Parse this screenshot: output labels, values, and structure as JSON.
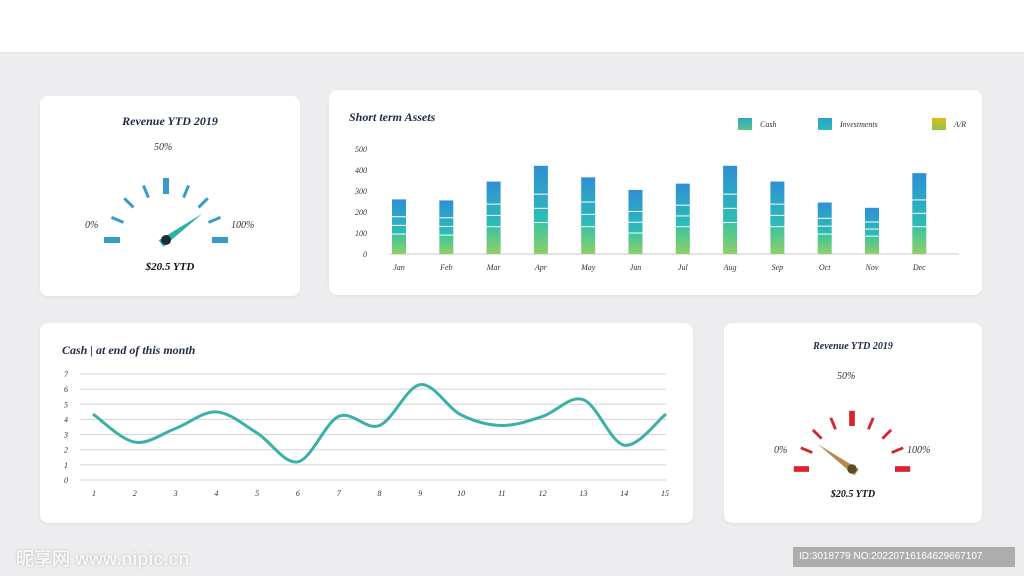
{
  "colors": {
    "teal": "#3ab0a6",
    "gauge_blue": "#3a9bc9",
    "gauge_red": "#d9242d",
    "cash_green": "#5cc481",
    "investments_blue": "#2ea5c8",
    "ar_gold": "#e6b817"
  },
  "gauge_top": {
    "title": "Revenue YTD 2019",
    "label_mid": "50%",
    "label_min": "0%",
    "label_max": "100%",
    "value_text": "$20.5 YTD",
    "needle_percent": 80,
    "color": "#3a9bc9",
    "icons": {
      "needle": "needle-icon"
    }
  },
  "gauge_bottom": {
    "title": "Revenue YTD 2019",
    "label_mid": "50%",
    "label_min": "0%",
    "label_max": "100%",
    "value_text": "$20.5 YTD",
    "needle_percent": 20,
    "color": "#d9242d",
    "icons": {
      "needle": "needle-icon"
    }
  },
  "bar_panel": {
    "title": "Short term Assets",
    "legend": [
      {
        "label": "Cash",
        "color": "#5cc481"
      },
      {
        "label": "Investments",
        "color": "#2ea5c8"
      },
      {
        "label": "A/R",
        "color": "#e6b817"
      }
    ]
  },
  "line_panel": {
    "title": "Cash | at end of this month"
  },
  "chart_data": [
    {
      "type": "bar",
      "title": "Short term Assets",
      "categories": [
        "Jan",
        "Feb",
        "Mar",
        "Apr",
        "May",
        "Jun",
        "Jul",
        "Aug",
        "Sep",
        "Oct",
        "Nov",
        "Dec"
      ],
      "y_ticks": [
        0,
        100,
        200,
        300,
        400,
        500
      ],
      "ylim": [
        0,
        500
      ],
      "total_values": [
        260,
        255,
        345,
        420,
        365,
        305,
        335,
        420,
        345,
        245,
        220,
        385
      ],
      "series": [
        {
          "name": "Cash",
          "values": [
            95,
            90,
            130,
            150,
            130,
            100,
            130,
            150,
            130,
            95,
            85,
            130
          ]
        }
      ],
      "legend": [
        "Cash",
        "Investments",
        "A/R"
      ],
      "legend_position": "top-right",
      "grid": false
    },
    {
      "type": "line",
      "title": "Cash | at end of this month",
      "x": [
        1,
        2,
        3,
        4,
        5,
        6,
        7,
        8,
        9,
        10,
        11,
        12,
        13,
        14,
        15
      ],
      "values": [
        4.3,
        2.5,
        3.4,
        4.5,
        3.1,
        1.2,
        4.2,
        3.6,
        6.3,
        4.3,
        3.6,
        4.2,
        5.3,
        2.3,
        4.3
      ],
      "y_ticks": [
        0,
        1,
        2,
        3,
        4,
        5,
        6,
        7
      ],
      "ylim": [
        0,
        7
      ],
      "grid": true,
      "color": "#3ab0a6"
    }
  ],
  "watermark": {
    "left_text": "昵享网 www.nipic.cn",
    "right_text": "ID:3018779 NO:20220716164629667107"
  }
}
